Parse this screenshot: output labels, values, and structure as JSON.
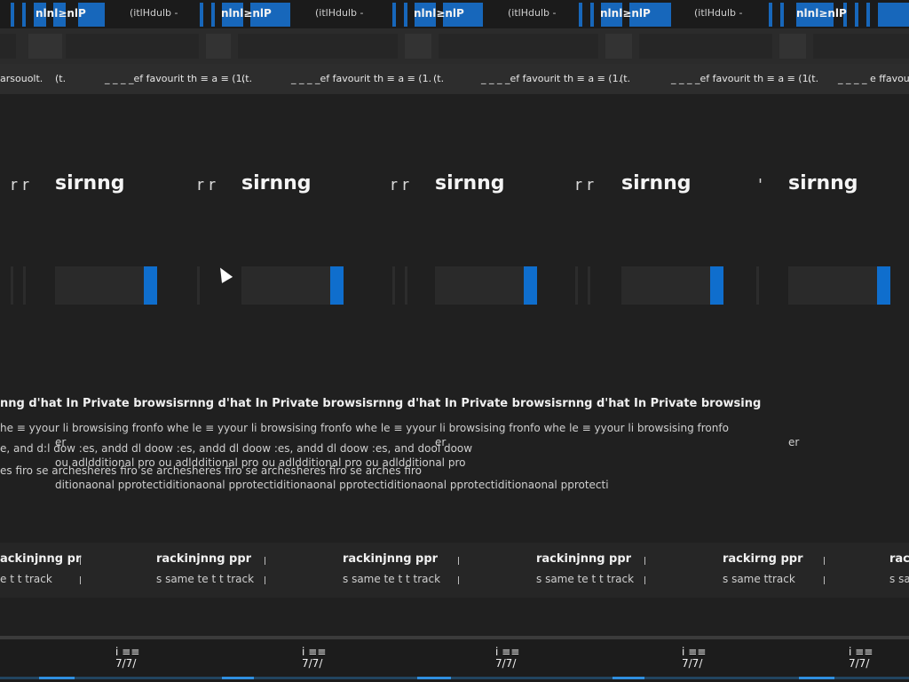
{
  "tabs": {
    "tab_texts": [
      "nlnl≥nlP",
      "nlnl≥nlP",
      "nlnl≥nlP",
      "nlnl≥nlP",
      "nlnl≥nlP"
    ],
    "titles": [
      "(itlHdulb -",
      "(itlHdulb -",
      "(itlHdulb -",
      "(itlHdulb -",
      "(itlHdulb -"
    ]
  },
  "favorites": {
    "items": [
      "arsouolt.",
      "(t.",
      "_ _ _ _ef favourit th ≡ a ≡ (1.",
      "(t.",
      "_ _ _ _ef favourit th ≡ a ≡ (1.",
      "(t.",
      "_ _ _ _ef favourit th ≡ a ≡ (1.",
      "(t.",
      "_ _ _ _ef favourit th ≡ a ≡ (1.",
      "(t.",
      "_ _ _ _ e ffavourit"
    ]
  },
  "page": {
    "heading_marks": [
      "r r",
      "r r",
      "r r",
      "r r",
      "'"
    ],
    "headings": [
      "sirnng",
      "sirnng",
      "sirnng",
      "sirnng",
      "sirnng"
    ],
    "info": {
      "head": "nng d'hat In Private browsisrnng d'hat In Private browsisrnng d'hat In Private browsisrnng d'hat In Private browsing",
      "line1": "he ≡ yyour li browsising fronfo whe le ≡ yyour li browsising fronfo whe le ≡ yyour li browsising fronfo whe le ≡ yyour li browsising fronfo",
      "line2a": "er",
      "line2b": "er",
      "line2c": "er",
      "line3": "e, and d:l dow  :es, andd dl doow  :es, andd dl doow  :es, andd dl doow  :es, and dool doow",
      "line4": "ou adldditional pro    ou adldditional pro    ou adldditional pro    ou adldditional pro",
      "line5": "es firo  se archesheres firo  se archesheres firo  se archesheres firo  se arches firo",
      "line6": "ditionaonal pprotectiditionaonal pprotectiditionaonal pprotectiditionaonal pprotectiditionaonal pprotecti"
    },
    "tracking": {
      "heads": [
        "ackinjnng pr",
        "rackinjnng ppr",
        "rackinjnng ppr",
        "rackinjnng ppr",
        "rackirng ppr",
        "rack"
      ],
      "subs": [
        "e t t track",
        "s same te t t track",
        "s same te t t track",
        "s same te t t track",
        "s same ttrack",
        "s sa"
      ]
    }
  },
  "footer": {
    "icons": [
      "i ≡≡\n7/7/",
      "i ≡≡\n7/7/",
      "i ≡≡\n7/7/",
      "i ≡≡\n7/7/",
      "i ≡≡\n7/7/"
    ]
  },
  "colors": {
    "accent": "#0f6ecd",
    "tab_accent": "#1767bb",
    "background": "#202020"
  }
}
